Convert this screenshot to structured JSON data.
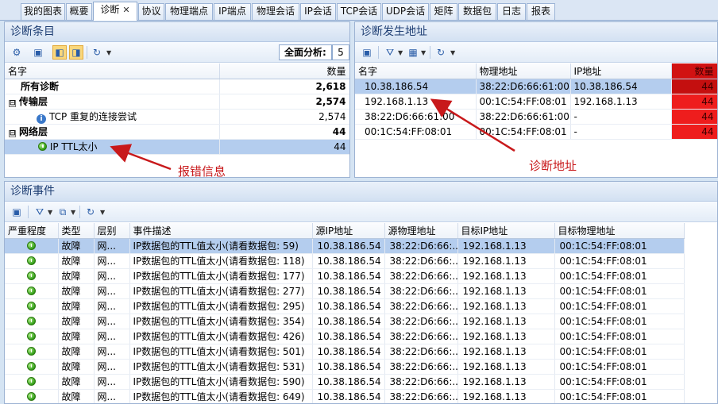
{
  "tabs": [
    {
      "label": "我的图表"
    },
    {
      "label": "概要"
    },
    {
      "label": "诊断",
      "active": true,
      "close": "✕"
    },
    {
      "label": "协议"
    },
    {
      "label": "物理端点"
    },
    {
      "label": "IP端点"
    },
    {
      "label": "物理会话"
    },
    {
      "label": "IP会话"
    },
    {
      "label": "TCP会话"
    },
    {
      "label": "UDP会话"
    },
    {
      "label": "矩阵"
    },
    {
      "label": "数据包"
    },
    {
      "label": "日志"
    },
    {
      "label": "报表"
    }
  ],
  "diag_items": {
    "title": "诊断条目",
    "full_analysis_label": "全面分析:",
    "full_analysis_value": "5",
    "columns": {
      "name": "名字",
      "count": "数量"
    },
    "rows": [
      {
        "name": "所有诊断",
        "count": "2,618"
      },
      {
        "name": "传输层",
        "count": "2,574",
        "expander": "⊟"
      },
      {
        "name": "TCP 重复的连接尝试",
        "count": "2,574"
      },
      {
        "name": "网络层",
        "count": "44",
        "expander": "⊟"
      },
      {
        "name": "IP TTL太小",
        "count": "44"
      }
    ]
  },
  "diag_addresses": {
    "title": "诊断发生地址",
    "columns": {
      "name": "名字",
      "mac": "物理地址",
      "ip": "IP地址",
      "count": "数量"
    },
    "rows": [
      {
        "name": "10.38.186.54",
        "mac": "38:22:D6:66:61:00",
        "ip": "10.38.186.54",
        "count": "44"
      },
      {
        "name": "192.168.1.13",
        "mac": "00:1C:54:FF:08:01",
        "ip": "192.168.1.13",
        "count": "44"
      },
      {
        "name": "38:22:D6:66:61:00",
        "mac": "38:22:D6:66:61:00",
        "ip": "-",
        "count": "44"
      },
      {
        "name": "00:1C:54:FF:08:01",
        "mac": "00:1C:54:FF:08:01",
        "ip": "-",
        "count": "44"
      }
    ]
  },
  "diag_events": {
    "title": "诊断事件",
    "columns": {
      "severity": "严重程度",
      "type": "类型",
      "layer": "层别",
      "desc": "事件描述",
      "src_ip": "源IP地址",
      "src_mac": "源物理地址",
      "dst_ip": "目标IP地址",
      "dst_mac": "目标物理地址"
    },
    "rows": [
      {
        "type": "故障",
        "layer": "网...",
        "desc": "IP数据包的TTL值太小(请看数据包: 59)",
        "src_ip": "10.38.186.54",
        "src_mac": "38:22:D6:66:...",
        "dst_ip": "192.168.1.13",
        "dst_mac": "00:1C:54:FF:08:01"
      },
      {
        "type": "故障",
        "layer": "网...",
        "desc": "IP数据包的TTL值太小(请看数据包: 118)",
        "src_ip": "10.38.186.54",
        "src_mac": "38:22:D6:66:...",
        "dst_ip": "192.168.1.13",
        "dst_mac": "00:1C:54:FF:08:01"
      },
      {
        "type": "故障",
        "layer": "网...",
        "desc": "IP数据包的TTL值太小(请看数据包: 177)",
        "src_ip": "10.38.186.54",
        "src_mac": "38:22:D6:66:...",
        "dst_ip": "192.168.1.13",
        "dst_mac": "00:1C:54:FF:08:01"
      },
      {
        "type": "故障",
        "layer": "网...",
        "desc": "IP数据包的TTL值太小(请看数据包: 277)",
        "src_ip": "10.38.186.54",
        "src_mac": "38:22:D6:66:...",
        "dst_ip": "192.168.1.13",
        "dst_mac": "00:1C:54:FF:08:01"
      },
      {
        "type": "故障",
        "layer": "网...",
        "desc": "IP数据包的TTL值太小(请看数据包: 295)",
        "src_ip": "10.38.186.54",
        "src_mac": "38:22:D6:66:...",
        "dst_ip": "192.168.1.13",
        "dst_mac": "00:1C:54:FF:08:01"
      },
      {
        "type": "故障",
        "layer": "网...",
        "desc": "IP数据包的TTL值太小(请看数据包: 354)",
        "src_ip": "10.38.186.54",
        "src_mac": "38:22:D6:66:...",
        "dst_ip": "192.168.1.13",
        "dst_mac": "00:1C:54:FF:08:01"
      },
      {
        "type": "故障",
        "layer": "网...",
        "desc": "IP数据包的TTL值太小(请看数据包: 426)",
        "src_ip": "10.38.186.54",
        "src_mac": "38:22:D6:66:...",
        "dst_ip": "192.168.1.13",
        "dst_mac": "00:1C:54:FF:08:01"
      },
      {
        "type": "故障",
        "layer": "网...",
        "desc": "IP数据包的TTL值太小(请看数据包: 501)",
        "src_ip": "10.38.186.54",
        "src_mac": "38:22:D6:66:...",
        "dst_ip": "192.168.1.13",
        "dst_mac": "00:1C:54:FF:08:01"
      },
      {
        "type": "故障",
        "layer": "网...",
        "desc": "IP数据包的TTL值太小(请看数据包: 531)",
        "src_ip": "10.38.186.54",
        "src_mac": "38:22:D6:66:...",
        "dst_ip": "192.168.1.13",
        "dst_mac": "00:1C:54:FF:08:01"
      },
      {
        "type": "故障",
        "layer": "网...",
        "desc": "IP数据包的TTL值太小(请看数据包: 590)",
        "src_ip": "10.38.186.54",
        "src_mac": "38:22:D6:66:...",
        "dst_ip": "192.168.1.13",
        "dst_mac": "00:1C:54:FF:08:01"
      },
      {
        "type": "故障",
        "layer": "网...",
        "desc": "IP数据包的TTL值太小(请看数据包: 649)",
        "src_ip": "10.38.186.54",
        "src_mac": "38:22:D6:66:...",
        "dst_ip": "192.168.1.13",
        "dst_mac": "00:1C:54:FF:08:01"
      }
    ]
  },
  "annotations": {
    "error_info": "报错信息",
    "diag_address": "诊断地址"
  },
  "colors": {
    "annotation": "#c8191b",
    "count_cell": "#ee1d1d",
    "count_cell_selected": "#c40f0f",
    "selection": "#b4cdee",
    "panel_title": "#1e3e73"
  }
}
